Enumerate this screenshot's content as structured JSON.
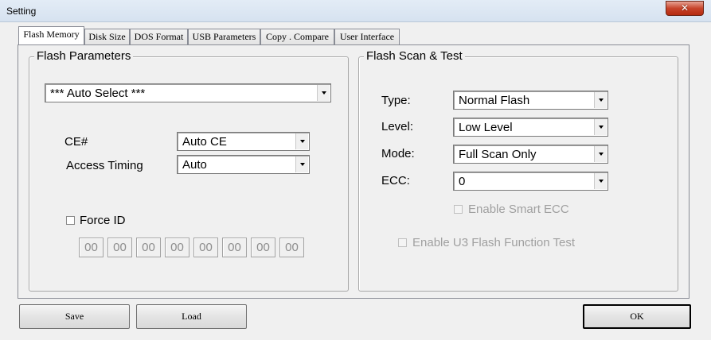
{
  "window": {
    "title": "Setting",
    "close_label": "✕"
  },
  "tabs": [
    {
      "label": "Flash Memory",
      "active": true
    },
    {
      "label": "Disk Size"
    },
    {
      "label": "DOS Format"
    },
    {
      "label": "USB Parameters"
    },
    {
      "label": "Copy . Compare"
    },
    {
      "label": "User Interface"
    }
  ],
  "flash_parameters": {
    "title": "Flash Parameters",
    "flash_select": "*** Auto Select ***",
    "ce_label": "CE#",
    "ce_value": "Auto CE",
    "timing_label": "Access Timing",
    "timing_value": "Auto",
    "force_id_label": "Force ID",
    "force_id_checked": false,
    "id_bytes": [
      "00",
      "00",
      "00",
      "00",
      "00",
      "00",
      "00",
      "00"
    ]
  },
  "flash_scan": {
    "title": "Flash Scan & Test",
    "type_label": "Type:",
    "type_value": "Normal Flash",
    "level_label": "Level:",
    "level_value": "Low Level",
    "mode_label": "Mode:",
    "mode_value": "Full Scan Only",
    "ecc_label": "ECC:",
    "ecc_value": "0",
    "smart_ecc_label": "Enable Smart ECC",
    "u3_label": "Enable U3 Flash Function Test"
  },
  "buttons": {
    "save": "Save",
    "load": "Load",
    "ok": "OK"
  }
}
